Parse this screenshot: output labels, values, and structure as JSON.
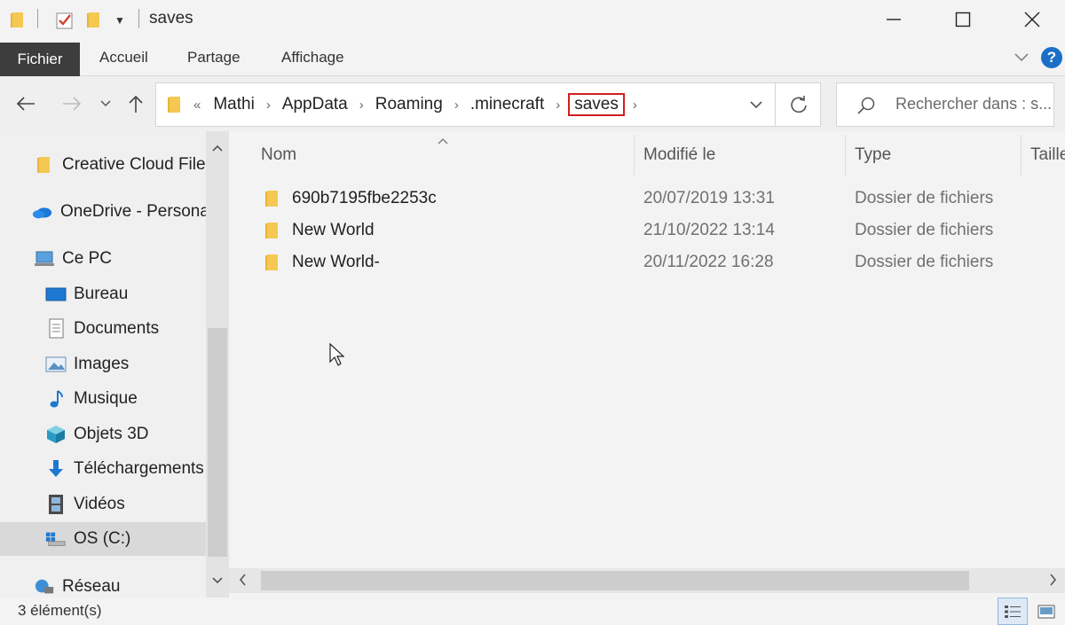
{
  "window": {
    "title": "saves",
    "controls": {
      "minimize": "minimize-icon",
      "maximize": "maximize-icon",
      "close": "close-icon"
    }
  },
  "ribbon": {
    "tabs": [
      "Fichier",
      "Accueil",
      "Partage",
      "Affichage"
    ],
    "help_label": "?"
  },
  "address": {
    "prefix": "«",
    "crumbs": [
      "Mathi",
      "AppData",
      "Roaming",
      ".minecraft"
    ],
    "current": "saves"
  },
  "search": {
    "placeholder": "Rechercher dans : s..."
  },
  "navpane": {
    "items": [
      {
        "label": "Creative Cloud Files",
        "icon": "folder-icon"
      },
      {
        "label": "OneDrive - Personal",
        "icon": "onedrive-cloud-icon"
      },
      {
        "label": "Ce PC",
        "icon": "computer-icon"
      },
      {
        "label": "Bureau",
        "icon": "desktop-icon"
      },
      {
        "label": "Documents",
        "icon": "documents-icon"
      },
      {
        "label": "Images",
        "icon": "images-icon"
      },
      {
        "label": "Musique",
        "icon": "music-icon"
      },
      {
        "label": "Objets 3D",
        "icon": "objects-3d-icon"
      },
      {
        "label": "Téléchargements",
        "icon": "download-icon"
      },
      {
        "label": "Vidéos",
        "icon": "videos-icon"
      },
      {
        "label": "OS (C:)",
        "icon": "drive-icon"
      },
      {
        "label": "Réseau",
        "icon": "network-icon"
      }
    ],
    "selected": "OS (C:)"
  },
  "columns": {
    "name": "Nom",
    "modified": "Modifié le",
    "type": "Type",
    "size": "Taille"
  },
  "files": [
    {
      "name": "690b7195fbe2253c",
      "modified": "20/07/2019 13:31",
      "type": "Dossier de fichiers"
    },
    {
      "name": "New World",
      "modified": "21/10/2022 13:14",
      "type": "Dossier de fichiers"
    },
    {
      "name": "New World-",
      "modified": "20/11/2022 16:28",
      "type": "Dossier de fichiers"
    }
  ],
  "status": {
    "count": "3 élément(s)"
  },
  "colors": {
    "folder": "#f2c14e",
    "highlight": "#d11f1f",
    "accent": "#1b6fc7"
  }
}
